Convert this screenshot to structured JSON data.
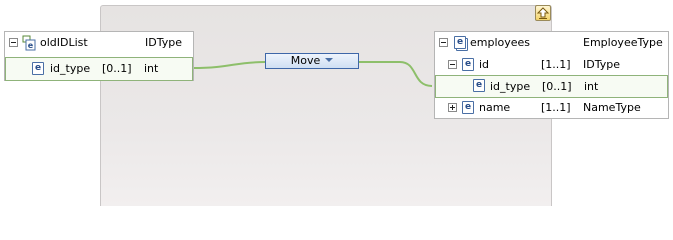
{
  "source": {
    "root": {
      "name": "oldIDList",
      "type": "IDType"
    },
    "child": {
      "name": "id_type",
      "cardinality": "[0..1]",
      "type": "int"
    }
  },
  "target": {
    "root": {
      "name": "employees",
      "type": "EmployeeType"
    },
    "rows": [
      {
        "name": "id",
        "cardinality": "[1..1]",
        "type": "IDType"
      },
      {
        "name": "id_type",
        "cardinality": "[0..1]",
        "type": "int"
      },
      {
        "name": "name",
        "cardinality": "[1..1]",
        "type": "NameType"
      }
    ]
  },
  "transform": {
    "label": "Move"
  },
  "icons": {
    "element": "e",
    "collapse": "minus-expander-icon",
    "expand": "plus-expander-icon",
    "go_up": "up-arrow-icon"
  },
  "colors": {
    "connector": "#8dbf6a",
    "transform_border": "#3e67a8",
    "selection_border": "#8fb37a"
  }
}
